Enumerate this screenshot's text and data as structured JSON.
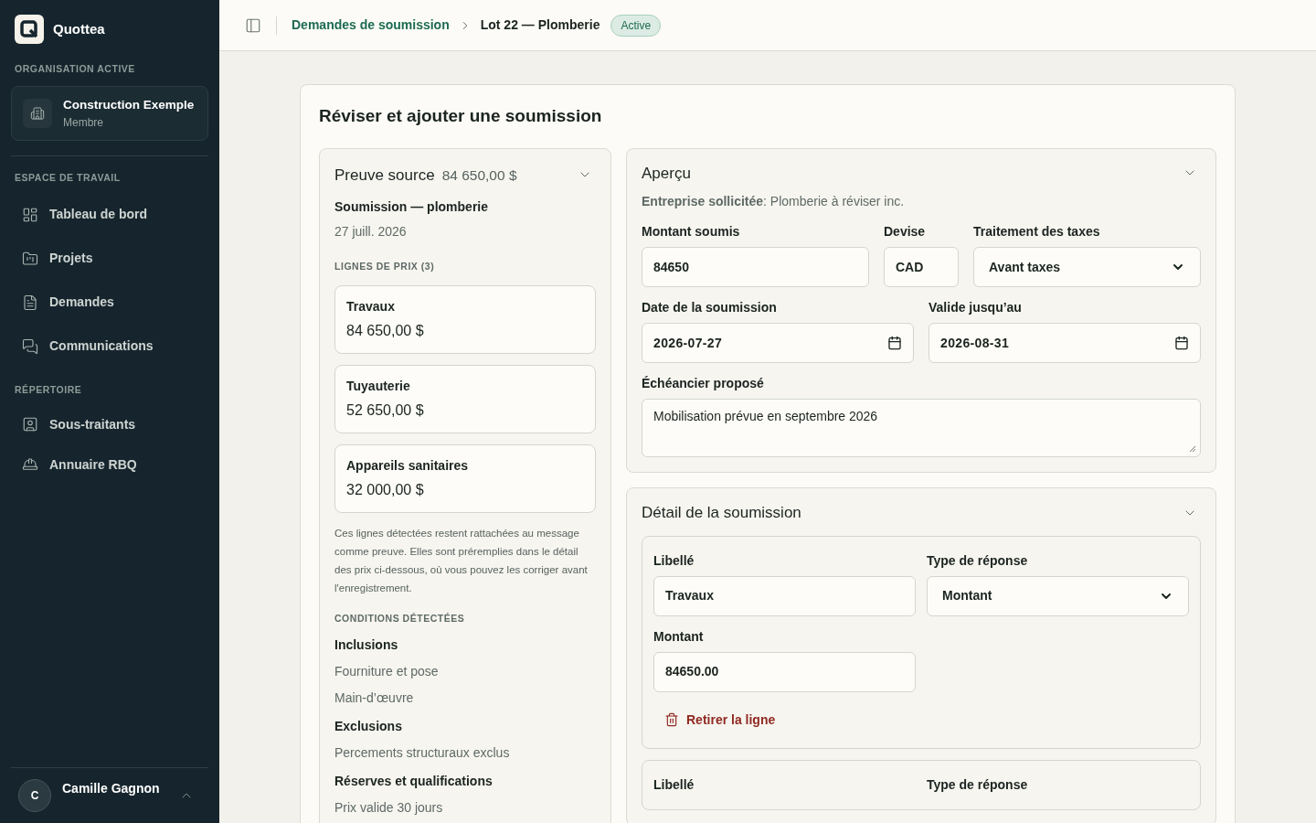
{
  "sidebar": {
    "brand": "Quottea",
    "org_heading": "ORGANISATION ACTIVE",
    "org": {
      "name": "Construction Exemple",
      "role": "Membre"
    },
    "sections": [
      {
        "heading": "ESPACE DE TRAVAIL",
        "items": [
          {
            "label": "Tableau de bord"
          },
          {
            "label": "Projets"
          },
          {
            "label": "Demandes"
          },
          {
            "label": "Communications"
          }
        ]
      },
      {
        "heading": "RÉPERTOIRE",
        "items": [
          {
            "label": "Sous-traitants"
          },
          {
            "label": "Annuaire RBQ"
          }
        ]
      }
    ],
    "user": {
      "initial": "C",
      "name": "Camille Gagnon"
    }
  },
  "header": {
    "parent": "Demandes de soumission",
    "current": "Lot 22 — Plomberie",
    "status": "Active"
  },
  "page": {
    "title": "Réviser et ajouter une soumission",
    "source": {
      "title": "Preuve source",
      "total": "84 650,00 $",
      "expanded": true,
      "doc_title": "Soumission — plomberie",
      "doc_date": "27 juill. 2026",
      "lines_heading": "LIGNES DE PRIX (3)",
      "lines": [
        {
          "label": "Travaux",
          "amount": "84 650,00 $"
        },
        {
          "label": "Tuyauterie",
          "amount": "52 650,00 $"
        },
        {
          "label": "Appareils sanitaires",
          "amount": "32 000,00 $"
        }
      ],
      "note": "Ces lignes détectées restent rattachées au message comme preuve. Elles sont préremplies dans le détail des prix ci-dessous, où vous pouvez les corriger avant l'enregistrement.",
      "conditions_heading": "CONDITIONS DÉTECTÉES",
      "conditions": [
        {
          "title": "Inclusions",
          "items": [
            "Fourniture et pose",
            "Main-d’œuvre"
          ]
        },
        {
          "title": "Exclusions",
          "items": [
            "Percements structuraux exclus"
          ]
        },
        {
          "title": "Réserves et qualifications",
          "items": [
            "Prix valide 30 jours"
          ]
        }
      ]
    },
    "overview": {
      "title": "Aperçu",
      "expanded": true,
      "company": "**Entreprise sollicitée**: Plomberie à réviser inc.",
      "rows": [
        [
          {
            "kind": "text",
            "label": "Montant soumis",
            "value": "84650"
          },
          {
            "kind": "text",
            "label": "Devise",
            "value": "CAD"
          },
          {
            "kind": "select",
            "label": "Traitement des taxes",
            "value": "Avant taxes"
          }
        ],
        [
          {
            "kind": "date",
            "label": "Date de la soumission",
            "value": "2026-07-27"
          },
          {
            "kind": "date",
            "label": "Valide jusqu’au",
            "value": "2026-08-31"
          }
        ],
        [
          {
            "kind": "textarea",
            "label": "Échéancier proposé",
            "value": "Mobilisation prévue en septembre 2026"
          }
        ]
      ]
    },
    "detail": {
      "title": "Détail de la soumission",
      "expanded": true,
      "lines": [
        {
          "label_title": "Libellé",
          "label_value": "Travaux",
          "type_title": "Type de réponse",
          "type_value": "Montant",
          "amount_title": "Montant",
          "amount_value": "84650.00",
          "remove": "Retirer la ligne"
        },
        {
          "label_title": "Libellé",
          "type_title": "Type de réponse"
        }
      ]
    }
  }
}
